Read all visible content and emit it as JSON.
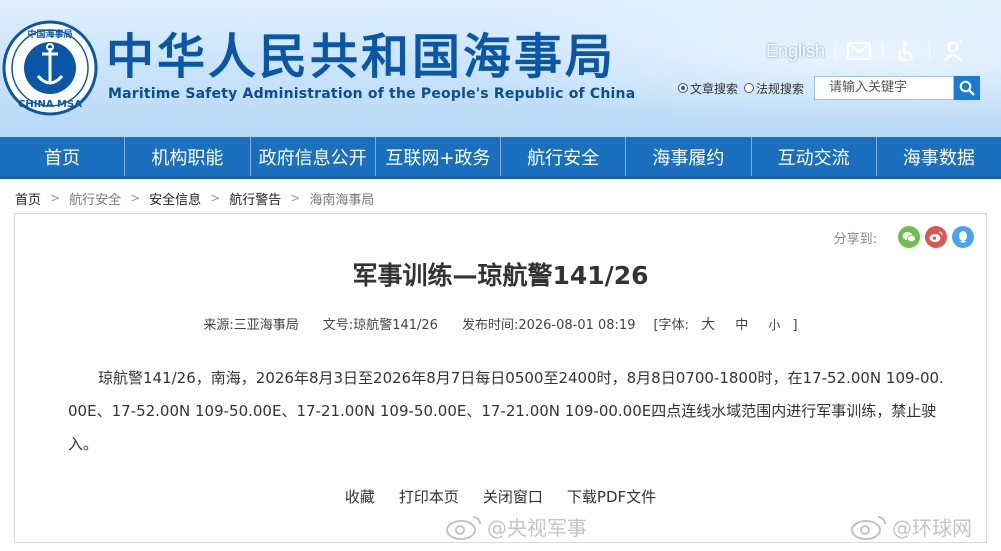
{
  "header": {
    "logo_text_top": "中国海事局",
    "logo_text_bottom": "CHINA MSA",
    "title_cn": "中华人民共和国海事局",
    "title_en": "Maritime Safety Administration of the People's Republic of China",
    "english_link": "English",
    "icons": [
      "mail-icon",
      "accessibility-icon",
      "elder-mode-icon"
    ]
  },
  "search": {
    "radio_article": "文章搜索",
    "radio_law": "法规搜索",
    "placeholder": "请输入关键字",
    "selected": "文章搜索"
  },
  "nav": {
    "items": [
      "首页",
      "机构职能",
      "政府信息公开",
      "互联网+政务",
      "航行安全",
      "海事履约",
      "互动交流",
      "海事数据"
    ]
  },
  "breadcrumb": [
    "首页",
    "航行安全",
    "安全信息",
    "航行警告",
    "海南海事局"
  ],
  "share": {
    "label": "分享到:",
    "icons": [
      "wechat-icon",
      "weibo-icon",
      "qq-icon"
    ]
  },
  "article": {
    "title": "军事训练—琼航警141/26",
    "source_label": "来源:",
    "source": "三亚海事局",
    "docno_label": "文号:",
    "docno": "琼航警141/26",
    "time_label": "发布时间:",
    "time": "2026-08-01 08:19",
    "font_open": "[字体:",
    "font_large": "大",
    "font_medium": "中",
    "font_small": "小",
    "font_close": "]",
    "body": "琼航警141/26，南海，2026年8月3日至2026年8月7日每日0500至2400时，8月8日0700-1800时，在17-52.00N 109-00.00E、17-52.00N 109-50.00E、17-21.00N 109-50.00E、17-21.00N 109-00.00E四点连线水域范围内进行军事训练，禁止驶入。"
  },
  "actions": [
    "收藏",
    "打印本页",
    "关闭窗口",
    "下载PDF文件"
  ],
  "watermarks": [
    "@央视军事",
    "@环球网"
  ],
  "colors": {
    "brand_blue": "#1a6fbf",
    "title_blue": "#0b57a7",
    "wechat": "#6cc04a",
    "weibo": "#e0554e",
    "qq": "#4aa3ef"
  }
}
